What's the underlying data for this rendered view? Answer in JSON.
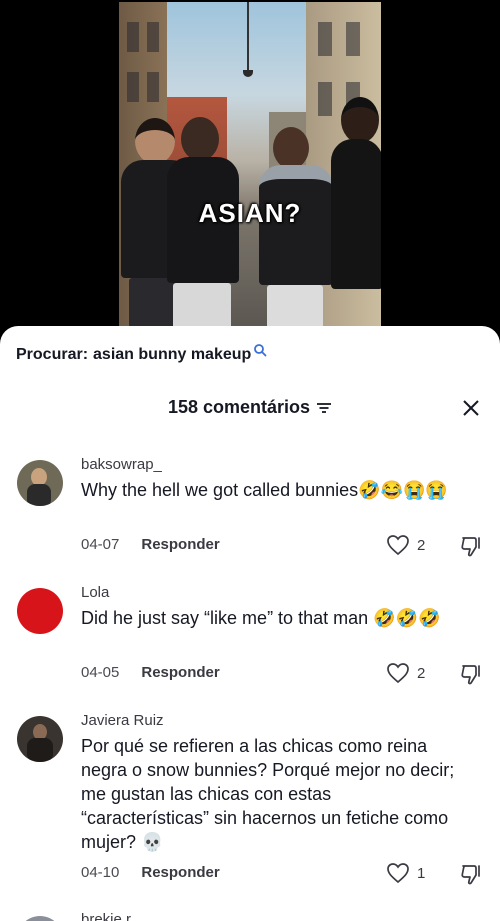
{
  "video": {
    "caption": "ASIAN?"
  },
  "search": {
    "prefix": "Procurar:",
    "query": "asian bunny makeup",
    "icon": "search-icon"
  },
  "comments_header": {
    "count_label": "158 comentários",
    "filter_icon": "filter-icon",
    "close_icon": "close-icon"
  },
  "comments": [
    {
      "username": "baksowrap_",
      "text": "Why the hell we got called bunnies🤣😂😭😭",
      "date": "04-07",
      "reply_label": "Responder",
      "likes": "2",
      "avatar_color": "#6f6a58"
    },
    {
      "username": "Lola",
      "text": "Did he just say “like me” to that man 🤣🤣🤣",
      "date": "04-05",
      "reply_label": "Responder",
      "likes": "2",
      "avatar_color": "#d8141b"
    },
    {
      "username": "Javiera Ruiz",
      "text": "Por qué se refieren a las chicas como reina negra o snow bunnies? Porqué mejor no decir; me gustan las chicas con estas “características” sin hacernos un fetiche como mujer? 💀",
      "date": "04-10",
      "reply_label": "Responder",
      "likes": "1",
      "avatar_color": "#3a3430"
    },
    {
      "username": "brekie r"
    }
  ]
}
